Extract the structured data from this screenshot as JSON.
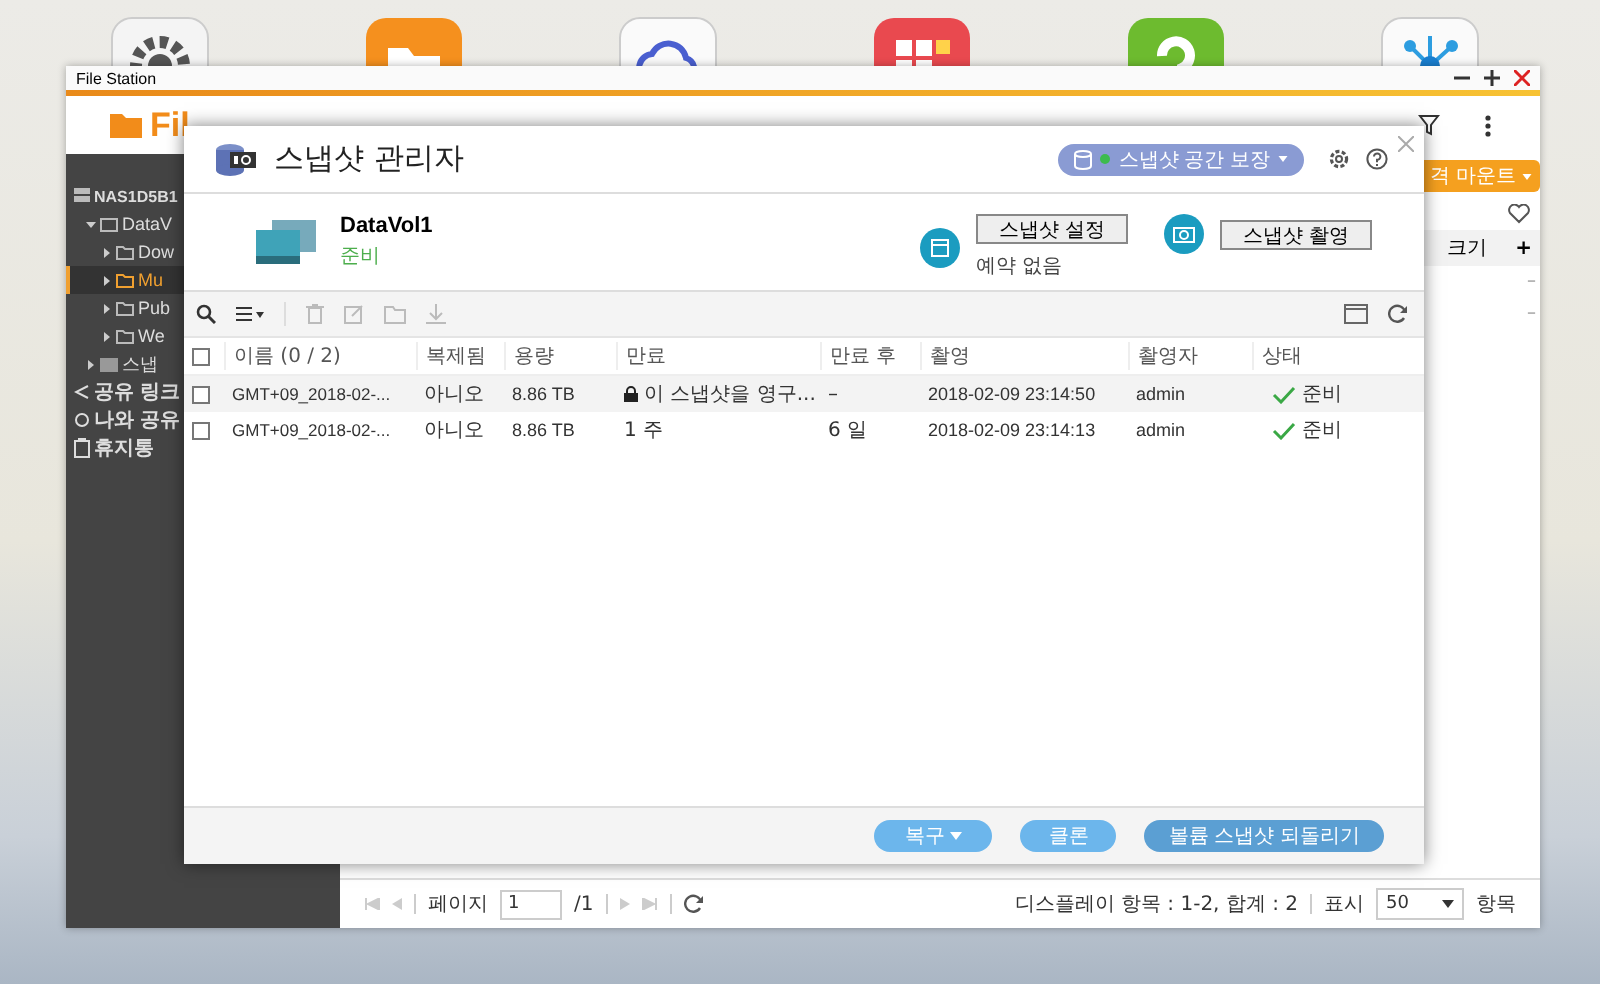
{
  "desktop_icons": [
    {
      "kind": "gear"
    },
    {
      "kind": "folder"
    },
    {
      "kind": "cloud"
    },
    {
      "kind": "tiles"
    },
    {
      "kind": "help"
    },
    {
      "kind": "network"
    }
  ],
  "file_station": {
    "title": "File Station",
    "logo_text": "Fil",
    "mount_button": "격 마운트",
    "tree": [
      {
        "label": "NAS1D5B1",
        "kind": "server",
        "selected": false,
        "children": [
          {
            "label": "DataV",
            "kind": "volume",
            "expanded": true,
            "selected": false,
            "children": [
              {
                "label": "Dow",
                "kind": "folder",
                "expanded": false,
                "selected": false
              },
              {
                "label": "Mu",
                "kind": "folder",
                "expanded": false,
                "selected": true
              },
              {
                "label": "Pub",
                "kind": "folder",
                "expanded": false,
                "selected": false
              },
              {
                "label": "We",
                "kind": "folder",
                "expanded": false,
                "selected": false
              }
            ]
          },
          {
            "label": "스냅",
            "kind": "snapshot",
            "expanded": false,
            "selected": false
          }
        ]
      }
    ],
    "links": [
      {
        "label": "공유 링크",
        "kind": "share"
      },
      {
        "label": "나와 공유",
        "kind": "shared"
      },
      {
        "label": "휴지통",
        "kind": "trash"
      }
    ],
    "size_column": "크기",
    "add_column": "+",
    "row_marks": [
      "–",
      "–"
    ],
    "pager": {
      "page_label": "페이지",
      "page": "1",
      "total_pages": "/1",
      "display": "디스플레이 항목 : 1-2, 합계 : 2",
      "show_label": "표시",
      "per_page": "50",
      "items_label": "항목"
    }
  },
  "dialog": {
    "title": "스냅샷 관리자",
    "space_button": "스냅샷 공간 보장",
    "volume": {
      "name": "DataVol1",
      "status": "준비"
    },
    "actions": [
      {
        "kind": "schedule",
        "label": "스냅샷 설정",
        "note": "예약 없음"
      },
      {
        "kind": "capture",
        "label": "스냅샷 촬영"
      }
    ],
    "toolbar": [
      {
        "kind": "search",
        "disabled": false
      },
      {
        "kind": "list",
        "disabled": false
      },
      {
        "kind": "delete",
        "disabled": true
      },
      {
        "kind": "edit",
        "disabled": true
      },
      {
        "kind": "folder",
        "disabled": true
      },
      {
        "kind": "download",
        "disabled": true
      }
    ],
    "select_all_checked": false,
    "columns": [
      "이름 (0 / 2)",
      "복제됨",
      "용량",
      "만료",
      "만료 후",
      "촬영",
      "촬영자",
      "상태"
    ],
    "rows": [
      {
        "selected": true,
        "checked": false,
        "name": "GMT+09_2018-02-...",
        "cloned": "아니오",
        "size": "8.86 TB",
        "expiry": "이 스냅샷을 영구...",
        "locked": true,
        "expires_in": "–",
        "taken": "2018-02-09 23:14:50",
        "taken_by": "admin",
        "status": "준비"
      },
      {
        "selected": false,
        "checked": false,
        "name": "GMT+09_2018-02-...",
        "cloned": "아니오",
        "size": "8.86 TB",
        "expiry": "1 주",
        "locked": false,
        "expires_in": "6 일",
        "taken": "2018-02-09 23:14:13",
        "taken_by": "admin",
        "status": "준비"
      }
    ],
    "footer_buttons": [
      {
        "label": "복구",
        "dropdown": true
      },
      {
        "label": "클론",
        "dropdown": false
      },
      {
        "label": "볼륨 스냅샷 되돌리기",
        "dropdown": false
      }
    ]
  }
}
